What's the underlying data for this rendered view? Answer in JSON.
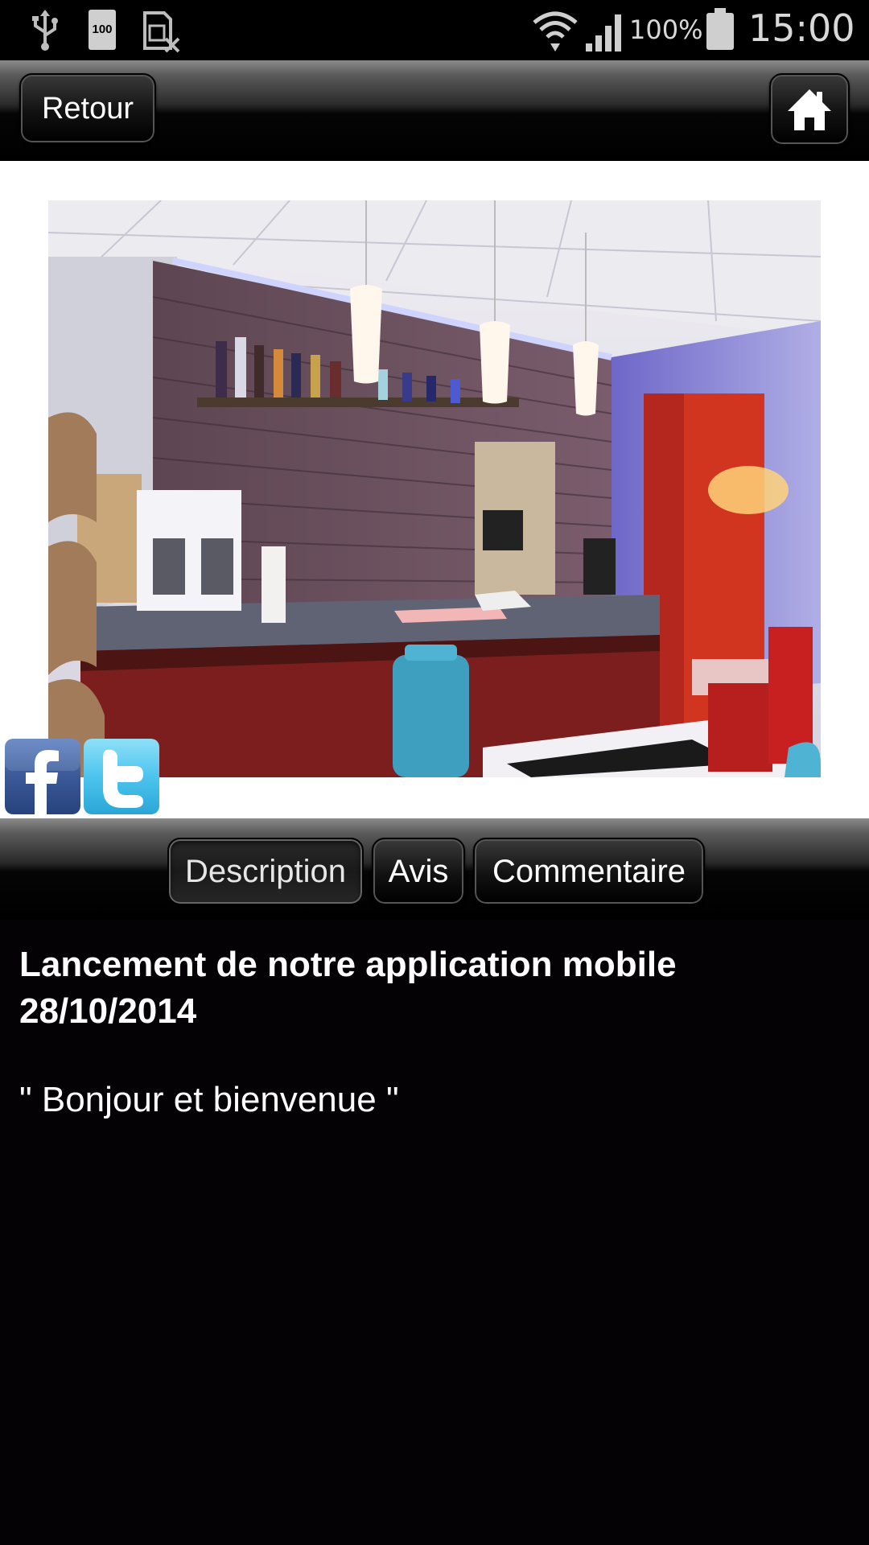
{
  "status_bar": {
    "icons": [
      "usb-icon",
      "battery-100-icon",
      "sim-missing-icon",
      "wifi-icon",
      "signal-icon",
      "battery-icon"
    ],
    "battery_percent": "100%",
    "time": "15:00",
    "battery_badge": "100"
  },
  "header": {
    "back_label": "Retour",
    "home_icon": "home-icon"
  },
  "social": {
    "facebook_icon": "facebook-icon",
    "twitter_icon": "twitter-icon"
  },
  "tabs": [
    {
      "label": "Description",
      "active": true
    },
    {
      "label": "Avis",
      "active": false
    },
    {
      "label": "Commentaire",
      "active": false
    }
  ],
  "content": {
    "title": "Lancement de notre application mobile 28/10/2014",
    "quote": "\" Bonjour et bienvenue \""
  }
}
